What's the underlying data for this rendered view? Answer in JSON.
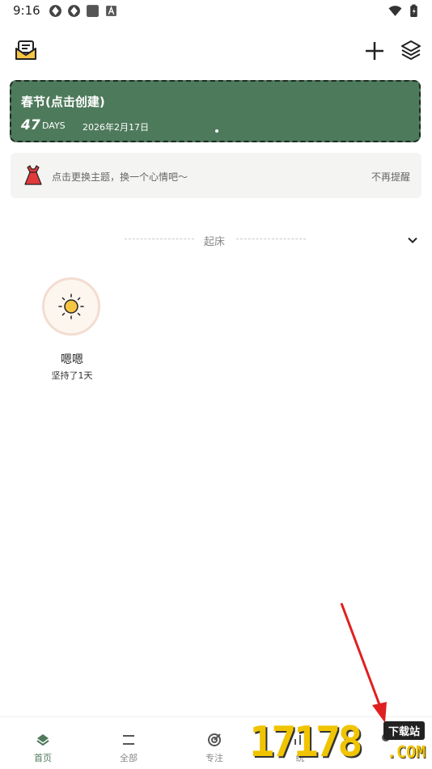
{
  "status_bar": {
    "time": "9:16"
  },
  "countdown": {
    "title": "春节(点击创建)",
    "days": "47",
    "unit": "DAYS",
    "date": "2026年2月17日"
  },
  "tip": {
    "text": "点击更换主题，换一个心情吧～",
    "dismiss": "不再提醒"
  },
  "section": {
    "title": "起床"
  },
  "habits": [
    {
      "name": "嗯嗯",
      "streak": "坚持了1天"
    }
  ],
  "nav": {
    "items": [
      {
        "label": "首页"
      },
      {
        "label": "全部"
      },
      {
        "label": "专注"
      },
      {
        "label": "统"
      },
      {
        "label": ""
      }
    ]
  },
  "watermark": {
    "number": "17178",
    "badge": "下载站",
    "domain": ".COM"
  },
  "colors": {
    "accent": "#4e7a5c",
    "card_border": "#1e2a22",
    "annotation_arrow": "#e02020"
  }
}
